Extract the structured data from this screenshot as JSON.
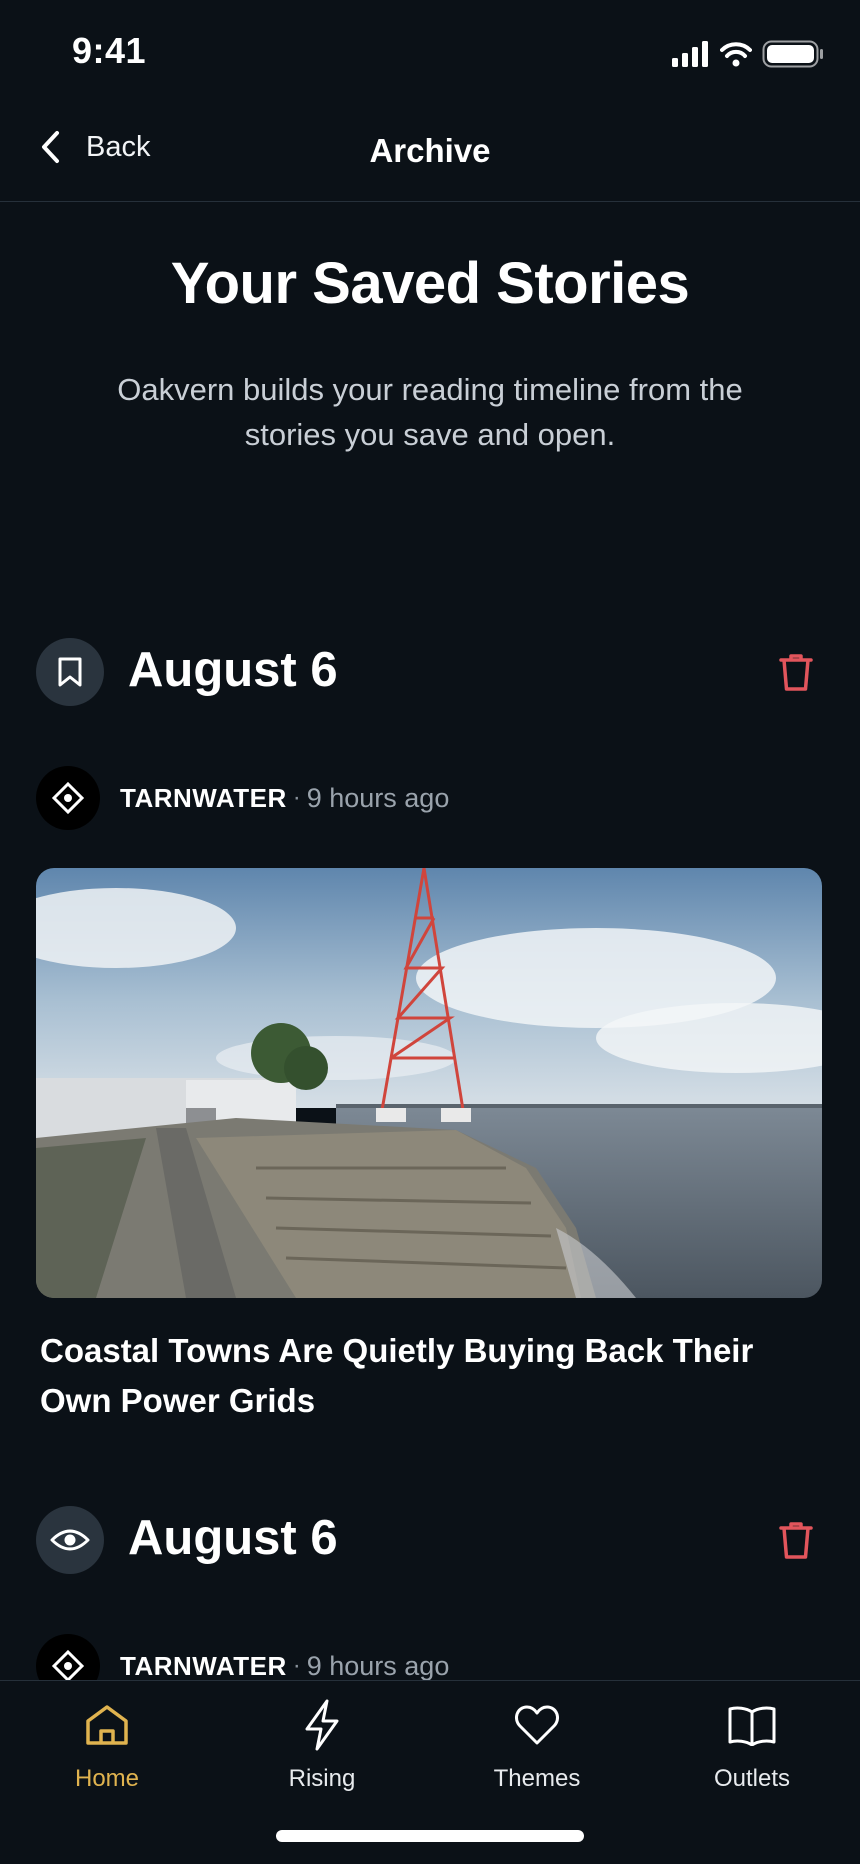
{
  "status_bar": {
    "time": "9:41"
  },
  "nav": {
    "back_label": "Back",
    "title": "Archive"
  },
  "hero": {
    "title": "Your Saved Stories",
    "subtitle": "Oakvern builds your reading timeline from the stories you save and open."
  },
  "entries": [
    {
      "date": "August 6",
      "kind_icon": "bookmark-icon",
      "source": "TARNWATER",
      "separator": "·",
      "time_ago": "9 hours ago",
      "headline": "Coastal Towns Are Quietly Buying Back Their Own Power Grids"
    },
    {
      "date": "August 6",
      "kind_icon": "eye-icon",
      "source": "TARNWATER",
      "separator": "·",
      "time_ago": "9 hours ago"
    }
  ],
  "tabs": [
    {
      "label": "Home",
      "icon": "home-icon",
      "active": true
    },
    {
      "label": "Rising",
      "icon": "bolt-icon",
      "active": false
    },
    {
      "label": "Themes",
      "icon": "heart-icon",
      "active": false
    },
    {
      "label": "Outlets",
      "icon": "book-icon",
      "active": false
    }
  ],
  "colors": {
    "background": "#0b1117",
    "accent": "#e0b34f",
    "danger": "#e2555c",
    "badge": "#2a343e"
  }
}
